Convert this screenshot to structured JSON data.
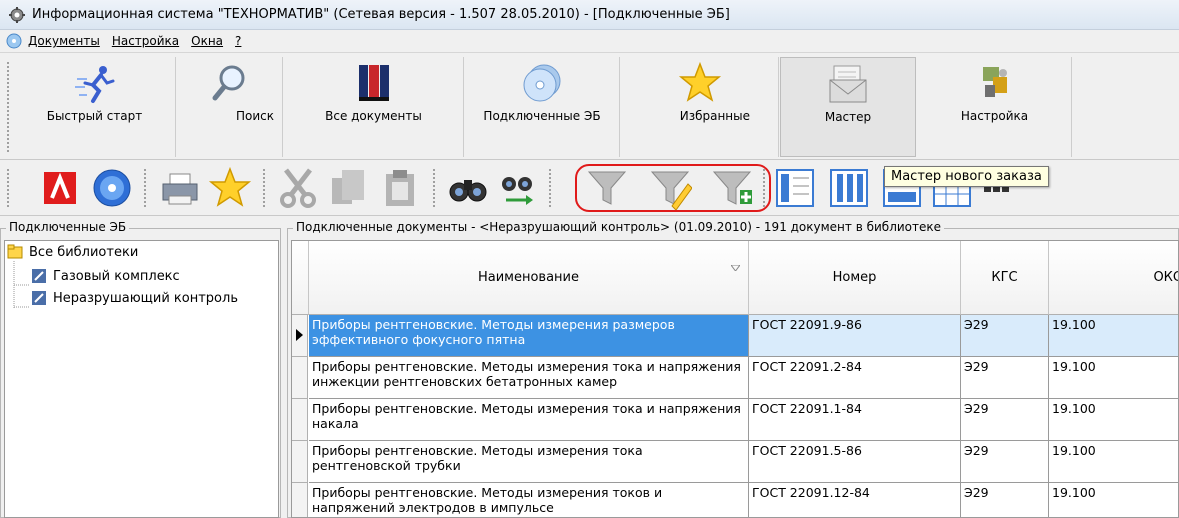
{
  "window": {
    "title": "Информационная система \"ТЕХНОРМАТИВ\" (Сетевая версия - 1.507 28.05.2010) - [Подключенные ЭБ]"
  },
  "menu": [
    "Документы",
    "Настройка",
    "Окна",
    "?"
  ],
  "big_toolbar": [
    {
      "label": "Быстрый старт",
      "icon": "runner-icon"
    },
    {
      "label": "Поиск",
      "icon": "magnifier-icon"
    },
    {
      "label": "Все документы",
      "icon": "books-icon"
    },
    {
      "label": "Подключенные ЭБ",
      "icon": "discs-icon"
    },
    {
      "label": "Избранные",
      "icon": "star-icon"
    },
    {
      "label": "Мастер",
      "icon": "envelope-icon"
    },
    {
      "label": "Настройка",
      "icon": "settings-icon"
    }
  ],
  "small_toolbar": {
    "icons": [
      "acrobat-icon",
      "disc-icon",
      "printer-icon",
      "star-icon",
      "cut-icon",
      "copy-icon",
      "paste-icon",
      "binoculars-icon",
      "binoculars-next-icon",
      "filter-icon",
      "filter-edit-icon",
      "filter-add-icon",
      "view-list-icon",
      "view-columns-icon",
      "view-table-icon",
      "view-grid-icon"
    ],
    "tooltip": "Мастер нового заказа",
    "highlight_color": "#e01a1a"
  },
  "left_panel": {
    "caption": "Подключенные ЭБ",
    "tree": [
      {
        "label": "Все библиотеки",
        "icon": "folder-icon"
      },
      {
        "label": "Газовый комплекс",
        "icon": "library-icon"
      },
      {
        "label": "Неразрушающий контроль",
        "icon": "library-icon"
      }
    ]
  },
  "right_panel": {
    "caption": "Подключенные документы - <Неразрушающий контроль> (01.09.2010) - 191 документ в библиотеке",
    "columns": [
      "Наименование",
      "Номер",
      "КГС",
      "ОКС"
    ],
    "rows": [
      {
        "name": "Приборы рентгеновские. Методы измерения размеров эффективного фокусного пятна",
        "number": "ГОСТ 22091.9-86",
        "kgs": "Э29",
        "oks": "19.100"
      },
      {
        "name": "Приборы рентгеновские. Методы измерения тока и напряжения инжекции рентгеновских бетатронных камер",
        "number": "ГОСТ 22091.2-84",
        "kgs": "Э29",
        "oks": "19.100"
      },
      {
        "name": "Приборы рентгеновские. Методы измерения тока и напряжения накала",
        "number": "ГОСТ 22091.1-84",
        "kgs": "Э29",
        "oks": "19.100"
      },
      {
        "name": "Приборы рентгеновские. Методы измерения тока рентгеновской трубки",
        "number": "ГОСТ 22091.5-86",
        "kgs": "Э29",
        "oks": "19.100"
      },
      {
        "name": "Приборы рентгеновские. Методы измерения токов и напряжений электродов в импульсе",
        "number": "ГОСТ 22091.12-84",
        "kgs": "Э29",
        "oks": "19.100"
      }
    ]
  }
}
